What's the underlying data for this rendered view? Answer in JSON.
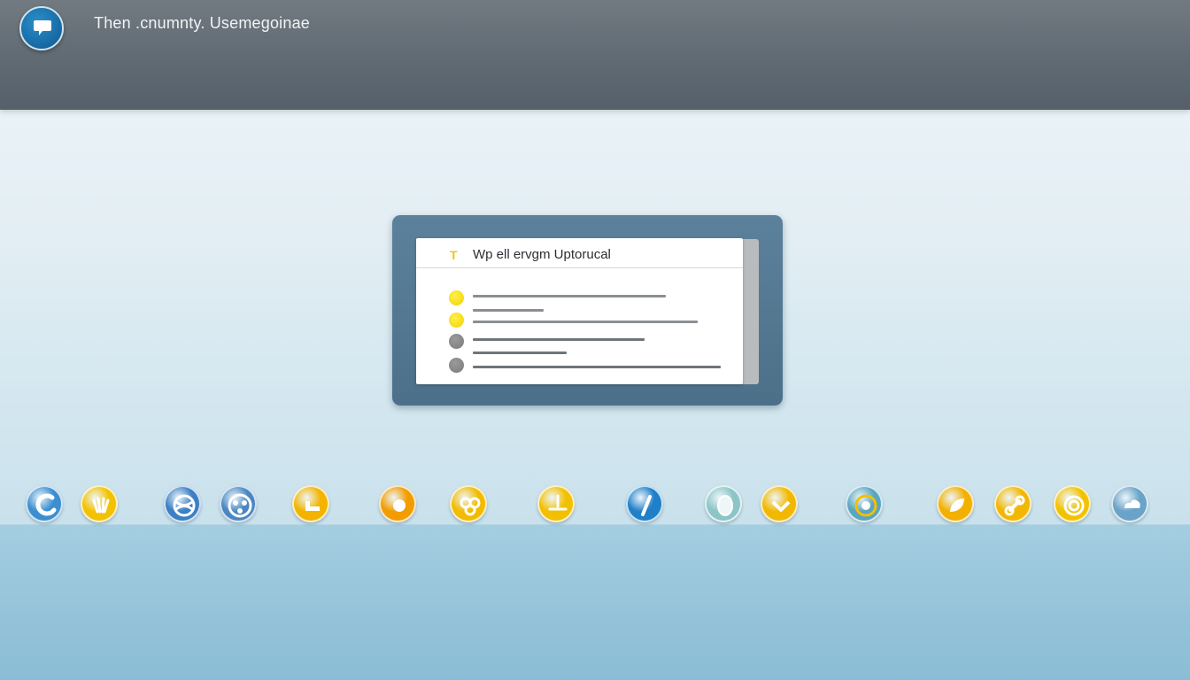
{
  "window": {
    "title": "Then .cnumnty.  Usemegoinae",
    "logo_icon": "speech-bubble-icon"
  },
  "dialog": {
    "title": "Wp ell ervgm Uptorucal",
    "title_icon": "T",
    "items": [
      {
        "bullet": "yellow"
      },
      {
        "bullet": "yellow"
      },
      {
        "bullet": "gray"
      },
      {
        "bullet": "gray"
      }
    ]
  },
  "dock": {
    "icons": [
      {
        "name": "browser-swirl-icon",
        "color": "#3b8fd0"
      },
      {
        "name": "hand-gesture-icon",
        "color": "#f2c200"
      },
      {
        "name": "globe-icon",
        "color": "#3b7fc4"
      },
      {
        "name": "network-globe-icon",
        "color": "#4a87c2"
      },
      {
        "name": "folder-tab-icon",
        "color": "#f2b400"
      },
      {
        "name": "target-circle-icon",
        "color": "#f29c00"
      },
      {
        "name": "cluster-icon",
        "color": "#f2bb00"
      },
      {
        "name": "downloads-icon",
        "color": "#f2c000"
      },
      {
        "name": "pen-icon",
        "color": "#1f7fc9"
      },
      {
        "name": "shield-icon",
        "color": "#8bc5c8"
      },
      {
        "name": "check-mail-icon",
        "color": "#f2b800"
      },
      {
        "name": "settings-gear-icon",
        "color": "#5aa5c0"
      },
      {
        "name": "leaf-app-icon",
        "color": "#f2b000"
      },
      {
        "name": "link-chain-icon",
        "color": "#f2b700"
      },
      {
        "name": "spiral-app-icon",
        "color": "#f2c200"
      },
      {
        "name": "cloud-sync-icon",
        "color": "#6aa3c8"
      }
    ]
  }
}
